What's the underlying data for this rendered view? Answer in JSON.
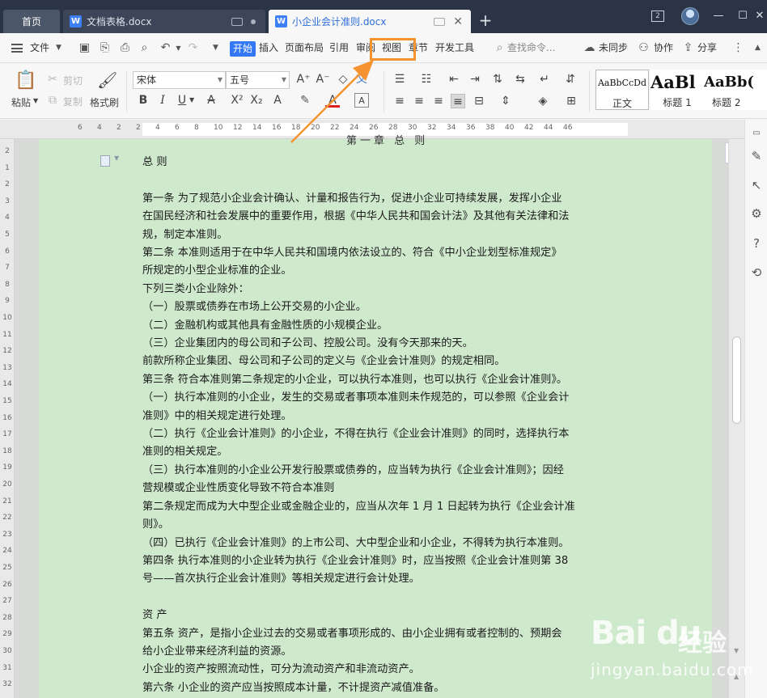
{
  "tabs": {
    "home": "首页",
    "doc1": "文档表格.docx",
    "doc2": "小企业会计准则.docx",
    "doc_icon": "W",
    "add": "+",
    "win_num": "2"
  },
  "menu": {
    "file": "文件",
    "start": "开始",
    "insert": "插入",
    "layout": "页面布局",
    "reference": "引用",
    "review": "审阅",
    "view": "视图",
    "chapter": "章节",
    "devtools": "开发工具",
    "search": "查找命令...",
    "sync": "未同步",
    "collab": "协作",
    "share": "分享"
  },
  "ribbon": {
    "paste": "粘贴",
    "cut": "剪切",
    "copy": "复制",
    "format_painter": "格式刷",
    "font_name": "宋体",
    "font_size": "五号",
    "styles": [
      {
        "preview": "AaBbCcDd",
        "name": "正文"
      },
      {
        "preview": "AaBl",
        "name": "标题 1"
      },
      {
        "preview": "AaBb(",
        "name": "标题 2"
      }
    ]
  },
  "document": {
    "top_cut_text": "第一章  总  则",
    "lines": [
      "总  则",
      "",
      "第一条  为了规范小企业会计确认、计量和报告行为，促进小企业可持续发展，发挥小企业",
      "在国民经济和社会发展中的重要作用，根据《中华人民共和国会计法》及其他有关法律和法",
      "规，制定本准则。",
      "第二条  本准则适用于在中华人民共和国境内依法设立的、符合《中小企业划型标准规定》",
      "所规定的小型企业标准的企业。",
      "下列三类小企业除外：",
      "（一）股票或债券在市场上公开交易的小企业。",
      "（二）金融机构或其他具有金融性质的小规模企业。",
      "（三）企业集团内的母公司和子公司、控股公司。没有今天那来的天。",
      "前款所称企业集团、母公司和子公司的定义与《企业会计准则》的规定相同。",
      "第三条  符合本准则第二条规定的小企业，可以执行本准则，也可以执行《企业会计准则》。",
      "（一）执行本准则的小企业，发生的交易或者事项本准则未作规范的，可以参照《企业会计",
      "准则》中的相关规定进行处理。",
      "（二）执行《企业会计准则》的小企业，不得在执行《企业会计准则》的同时，选择执行本",
      "准则的相关规定。",
      "（三）执行本准则的小企业公开发行股票或债券的，应当转为执行《企业会计准则》；因经",
      "营规模或企业性质变化导致不符合本准则",
      "第二条规定而成为大中型企业或金融企业的，应当从次年 1 月 1 日起转为执行《企业会计准",
      "则》。",
      "（四）已执行《企业会计准则》的上市公司、大中型企业和小企业，不得转为执行本准则。",
      "第四条  执行本准则的小企业转为执行《企业会计准则》时，应当按照《企业会计准则第 38",
      "号——首次执行企业会计准则》等相关规定进行会计处理。",
      "",
      "资  产",
      "第五条  资产，是指小企业过去的交易或者事项形成的、由小企业拥有或者控制的、预期会",
      "给小企业带来经济利益的资源。",
      "小企业的资产按照流动性，可分为流动资产和非流动资产。",
      "第六条  小企业的资产应当按照成本计量，不计提资产减值准备。"
    ]
  },
  "ruler": {
    "top": [
      "6",
      "4",
      "2",
      "2",
      "4",
      "6",
      "8",
      "10",
      "12",
      "14",
      "16",
      "18",
      "20",
      "22",
      "24",
      "26",
      "28",
      "30",
      "32",
      "34",
      "36",
      "38",
      "40",
      "42",
      "44",
      "46"
    ],
    "left": [
      "2",
      "1",
      "2",
      "3",
      "4",
      "5",
      "6",
      "7",
      "8",
      "9",
      "10",
      "11",
      "12",
      "13",
      "14",
      "15",
      "16",
      "17",
      "18",
      "19",
      "20",
      "21",
      "22",
      "23",
      "24",
      "25",
      "26",
      "27",
      "28",
      "29",
      "30",
      "31",
      "32"
    ]
  },
  "watermark": {
    "logo": "Bai du",
    "text": "经验",
    "url": "jingyan.baidu.com"
  },
  "colors": {
    "tabbar": "#2a3446",
    "accent": "#3478f6",
    "highlight": "#f59331",
    "page_bg": "#cfe9cd"
  }
}
